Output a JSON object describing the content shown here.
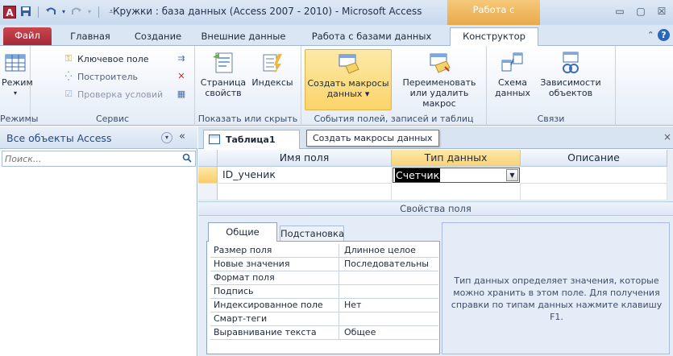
{
  "titlebar": {
    "app_icon": "A",
    "title": "Кружки : база данных (Access 2007 - 2010)  -  Microsoft Access",
    "context_tab_header": "Работа с таблицами",
    "minimize": "▭",
    "maximize": "▢",
    "close": "☒",
    "qat_icons": [
      "save-icon",
      "undo-icon",
      "redo-icon",
      "customize-qat-icon"
    ]
  },
  "ribbon_tabs": {
    "file": "Файл",
    "home": "Главная",
    "create": "Создание",
    "external": "Внешние данные",
    "database_tools": "Работа с базами данных",
    "design": "Конструктор",
    "help_icon": "help-icon"
  },
  "ribbon": {
    "views": {
      "mode_label": "Режим",
      "group_label": "Режимы"
    },
    "tools": {
      "primary_key": "Ключевое поле",
      "builder": "Построитель",
      "validation": "Проверка условий",
      "group_label": "Сервис"
    },
    "show_hide": {
      "property_sheet": "Страница свойств",
      "indexes": "Индексы",
      "group_label": "Показать или скрыть"
    },
    "field_events": {
      "create_macros": "Создать макросы данных ▾",
      "rename_delete_macro": "Переименовать или удалить макрос",
      "group_label": "События полей, записей и таблиц"
    },
    "relationships": {
      "data_schema": "Схема данных",
      "object_deps": "Зависимости объектов",
      "group_label": "Связи"
    }
  },
  "nav": {
    "title": "Все объекты Access",
    "search_placeholder": "Поиск...",
    "collapse": "«",
    "dropdown": "▾"
  },
  "document": {
    "tab_label": "Таблица1",
    "tooltip": "Создать макросы данных",
    "close": "×"
  },
  "grid": {
    "headers": {
      "field_name": "Имя поля",
      "data_type": "Тип данных",
      "description": "Описание"
    },
    "rows": [
      {
        "field_name": "ID_ученик",
        "data_type": "Счетчик",
        "description": ""
      }
    ]
  },
  "properties": {
    "bar_title": "Свойства поля",
    "tab_general": "Общие",
    "tab_lookup": "Подстановка",
    "rows": [
      {
        "name": "Размер поля",
        "value": "Длинное целое"
      },
      {
        "name": "Новые значения",
        "value": "Последовательны"
      },
      {
        "name": "Формат поля",
        "value": ""
      },
      {
        "name": "Подпись",
        "value": ""
      },
      {
        "name": "Индексированное поле",
        "value": "Нет"
      },
      {
        "name": "Смарт-теги",
        "value": ""
      },
      {
        "name": "Выравнивание текста",
        "value": "Общее"
      }
    ],
    "hint": "Тип данных определяет значения, которые можно хранить в этом поле. Для получения справки по типам данных нажмите клавишу F1."
  }
}
